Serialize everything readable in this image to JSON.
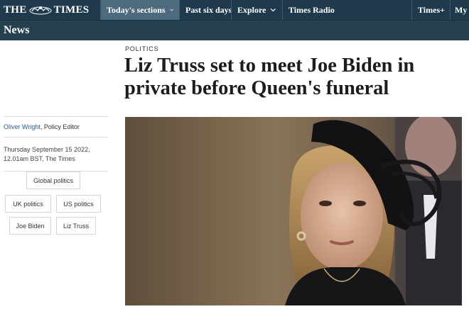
{
  "masthead": {
    "logo_left": "THE",
    "logo_right": "TIMES"
  },
  "nav": {
    "sections": "Today's sections",
    "past": "Past six days",
    "explore": "Explore",
    "radio": "Times Radio",
    "timesplus": "Times+",
    "my": "My"
  },
  "section": {
    "title": "News"
  },
  "article": {
    "kicker": "POLITICS",
    "headline": "Liz Truss set to meet Joe Biden in private before Queen's funeral",
    "author_name": "Oliver Wright",
    "author_role": ", Policy Editor",
    "date_line1": "Thursday September 15 2022,",
    "date_line2": "12.01am BST, The Times"
  },
  "tags": [
    "Global politics",
    "UK politics",
    "US politics",
    "Joe Biden",
    "Liz Truss"
  ],
  "colors": {
    "nav_bg": "#1f3a4d",
    "section_bg": "#25414f",
    "active_tab": "#4e6a7e",
    "author_link": "#2c5a8a"
  }
}
